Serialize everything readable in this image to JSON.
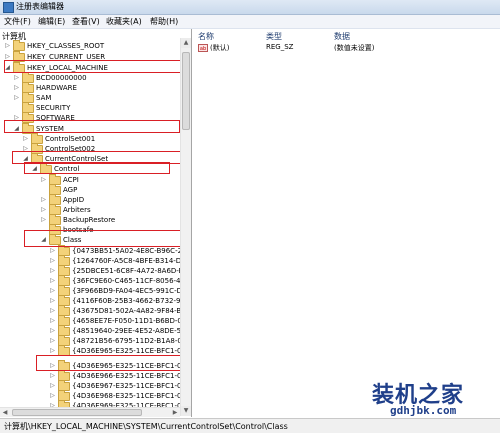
{
  "window": {
    "title": "注册表编辑器"
  },
  "menu": [
    "文件(F)",
    "编辑(E)",
    "查看(V)",
    "收藏夹(A)",
    "帮助(H)"
  ],
  "tree": {
    "header": "计算机",
    "rows": [
      {
        "label": "HKEY_CLASSES_ROOT",
        "toggle": "▷"
      },
      {
        "label": "HKEY_CURRENT_USER",
        "toggle": "▷"
      },
      {
        "label": "HKEY_LOCAL_MACHINE",
        "toggle": "◢"
      },
      {
        "label": "BCD00000000",
        "toggle": "▷"
      },
      {
        "label": "HARDWARE",
        "toggle": "▷"
      },
      {
        "label": "SAM",
        "toggle": "▷"
      },
      {
        "label": "SECURITY",
        "toggle": ""
      },
      {
        "label": "SOFTWARE",
        "toggle": "▷"
      },
      {
        "label": "SYSTEM",
        "toggle": "◢"
      },
      {
        "label": "ControlSet001",
        "toggle": "▷"
      },
      {
        "label": "ControlSet002",
        "toggle": "▷"
      },
      {
        "label": "CurrentControlSet",
        "toggle": "◢"
      },
      {
        "label": "Control",
        "toggle": "◢"
      },
      {
        "label": "ACPI",
        "toggle": "▷"
      },
      {
        "label": "AGP",
        "toggle": ""
      },
      {
        "label": "AppID",
        "toggle": "▷"
      },
      {
        "label": "Arbiters",
        "toggle": "▷"
      },
      {
        "label": "BackupRestore",
        "toggle": "▷"
      },
      {
        "label": "bootsafe",
        "toggle": ""
      },
      {
        "label": "Class",
        "toggle": "◢"
      },
      {
        "label": "{0473BB51-5A02-4E8C-B96C-29040F",
        "toggle": "▷"
      },
      {
        "label": "{1264760F-A5C8-4BFE-B314-D56A7E",
        "toggle": "▷"
      },
      {
        "label": "{25DBCE51-6C8F-4A72-8A6D-B54C2",
        "toggle": "▷"
      },
      {
        "label": "{36FC9E60-C465-11CF-8056-444553",
        "toggle": "▷"
      },
      {
        "label": "{3F966BD9-FA04-4EC5-991C-D32697",
        "toggle": "▷"
      },
      {
        "label": "{4116F60B-25B3-4662-B732-99A6111",
        "toggle": "▷"
      },
      {
        "label": "{43675D81-502A-4A82-9F84-B75F41",
        "toggle": "▷"
      },
      {
        "label": "{4658EE7E-F050-11D1-B6BD-00C04F",
        "toggle": "▷"
      },
      {
        "label": "{48519640-29EE-4E52-A8DE-5F8324C",
        "toggle": "▷"
      },
      {
        "label": "{48721B56-6795-11D2-B1A8-0080C7",
        "toggle": "▷"
      },
      {
        "label": "{4D36E965-E325-11CE-BFC1-08002B",
        "toggle": "▷"
      },
      {
        "label": "{4D36E965-E325-11CE-BFC1-08002B",
        "toggle": "▷"
      },
      {
        "label": "{4D36E966-E325-11CE-BFC1-08002B",
        "toggle": "▷"
      },
      {
        "label": "{4D36E967-E325-11CE-BFC1-08002B",
        "toggle": "▷"
      },
      {
        "label": "{4D36E968-E325-11CE-BFC1-08002B",
        "toggle": "▷"
      },
      {
        "label": "{4D36E969-E325-11CE-BFC1-08002B",
        "toggle": "▷"
      }
    ]
  },
  "list": {
    "columns": [
      "名称",
      "类型",
      "数据"
    ],
    "rows": [
      {
        "icon": "ab",
        "name": "(默认)",
        "type": "REG_SZ",
        "data": "(数值未设置)"
      }
    ]
  },
  "status": {
    "path": "计算机\\HKEY_LOCAL_MACHINE\\SYSTEM\\CurrentControlSet\\Control\\Class"
  },
  "watermark": {
    "title": "装机之家",
    "url": "gdhjbk.com"
  },
  "colors": {
    "highlight": "#d91f25",
    "folder": "#f3d27a"
  }
}
